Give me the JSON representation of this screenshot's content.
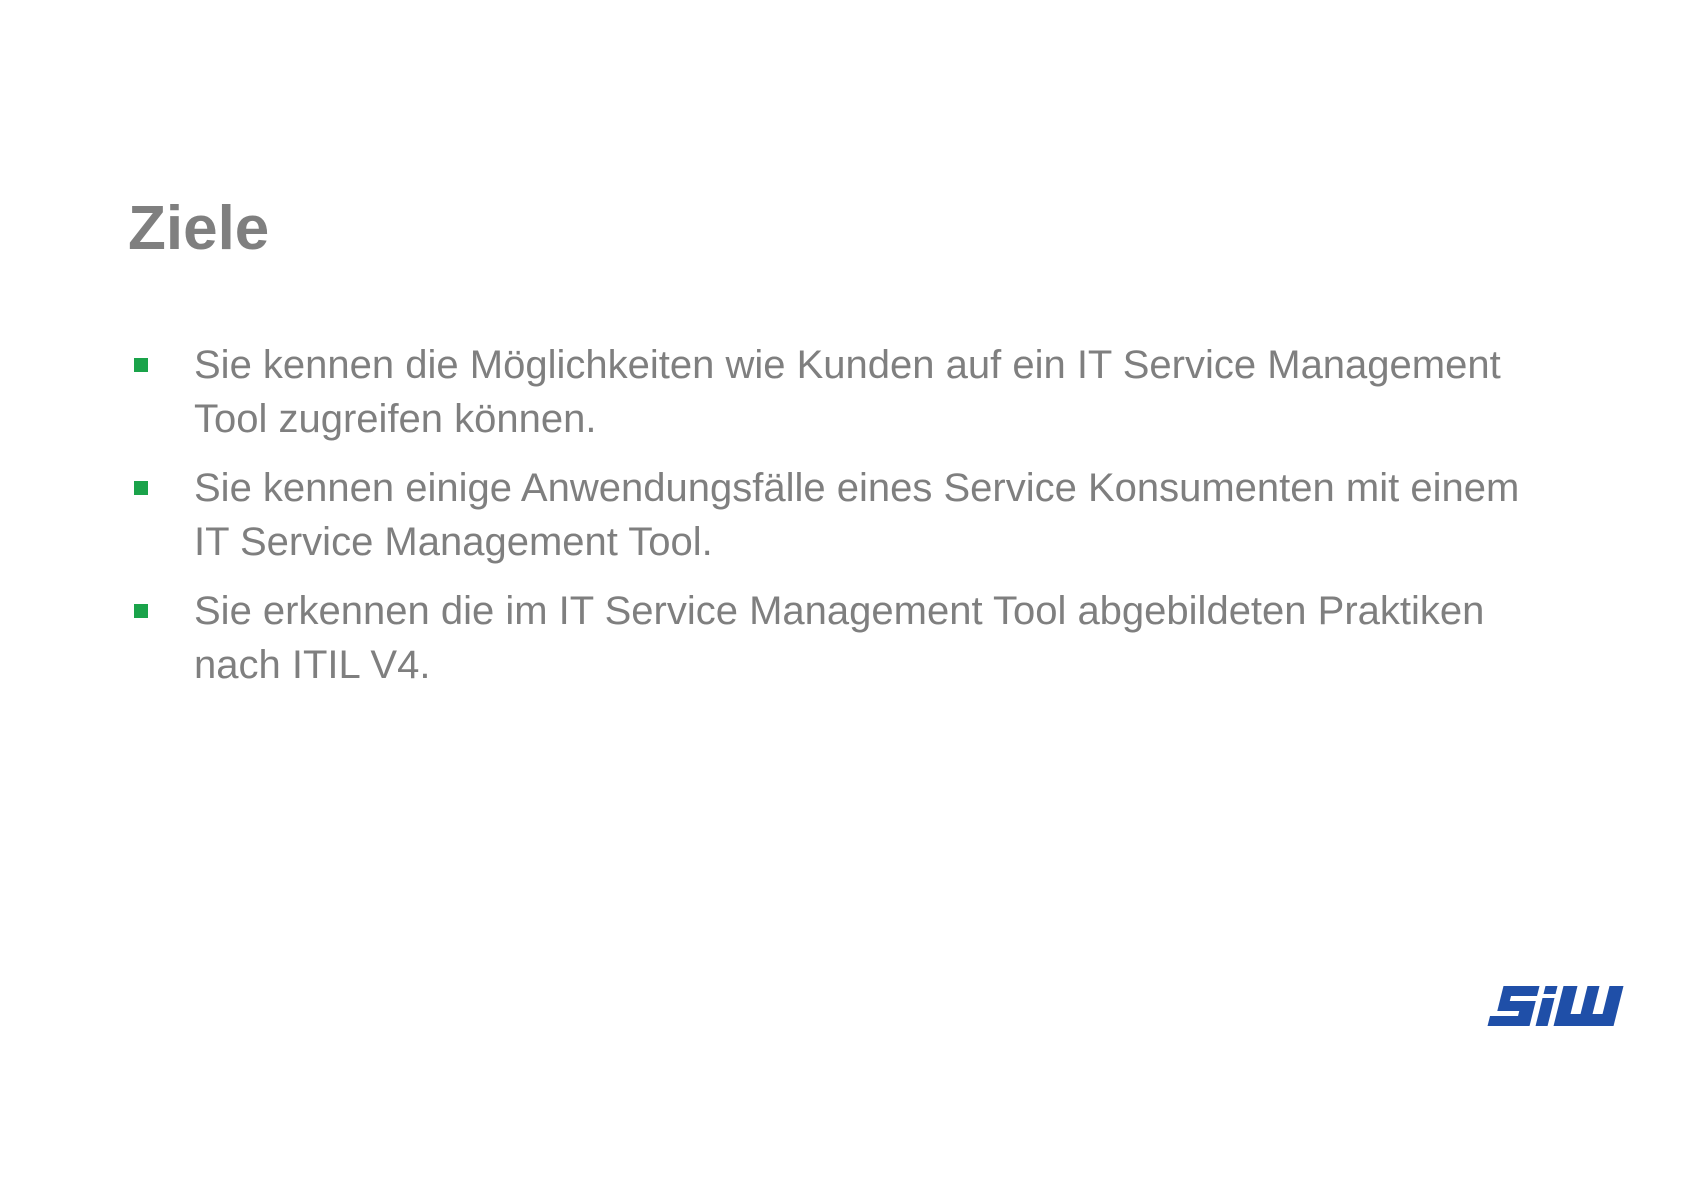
{
  "slide": {
    "title": "Ziele",
    "bullets": [
      {
        "text": "Sie kennen die Möglichkeiten wie Kunden auf ein IT Service Management Tool zugreifen können."
      },
      {
        "text": "Sie kennen einige Anwendungsfälle eines Service Konsumenten mit einem IT Service Management Tool."
      },
      {
        "text": "Sie erkennen die im IT Service Management Tool abgebildeten Praktiken nach ITIL V4."
      }
    ],
    "logo_text": "SIW"
  },
  "colors": {
    "text": "#7f7f7f",
    "bullet": "#1aa34a",
    "logo": "#1f4fa8"
  }
}
